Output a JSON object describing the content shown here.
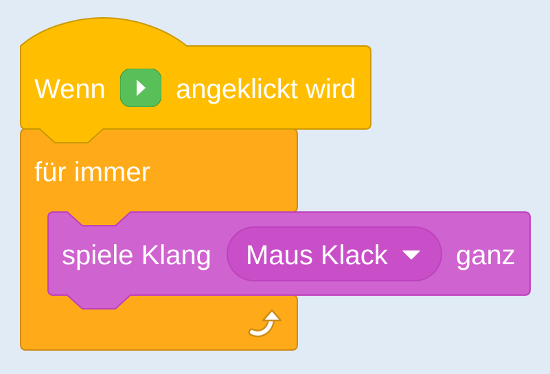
{
  "hat_block": {
    "prefix": "Wenn",
    "suffix": "angeklickt wird",
    "icon": "green-flag-icon",
    "color": "#ffbf00",
    "border_color": "#cc9900"
  },
  "forever_block": {
    "label": "für immer",
    "icon": "loop-arrow-icon",
    "color": "#ffab19",
    "border_color": "#cf8b17"
  },
  "sound_block": {
    "label": "spiele Klang",
    "sound_name": "Maus Klack",
    "suffix": "ganz",
    "color": "#cf63cf",
    "border_color": "#bd42bd",
    "dropdown_color": "#c94fc9",
    "dropdown_icon": "dropdown-arrow-icon"
  },
  "flag_color": "#59c059",
  "background_color": "#e1ebf6"
}
